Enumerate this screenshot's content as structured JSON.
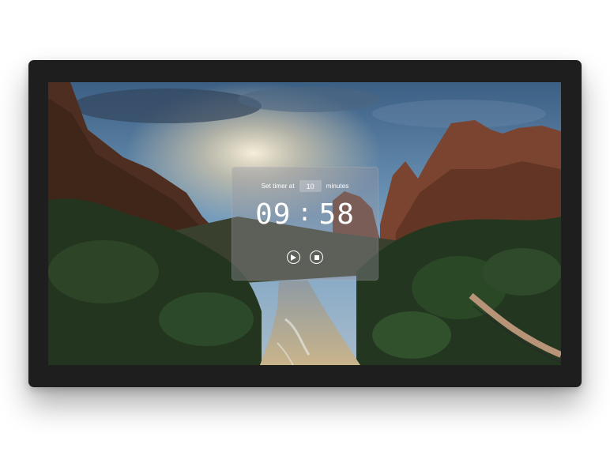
{
  "timer": {
    "label_prefix": "Set timer at",
    "minutes_value": "10",
    "label_suffix": "minutes",
    "clock_minutes": "09",
    "clock_separator": ":",
    "clock_seconds": "58"
  },
  "controls": {
    "play_icon": "play-icon",
    "stop_icon": "stop-icon"
  },
  "colors": {
    "device_frame": "#1e1e1e",
    "panel_overlay": "rgba(150,150,160,0.38)",
    "text": "#ffffff"
  }
}
